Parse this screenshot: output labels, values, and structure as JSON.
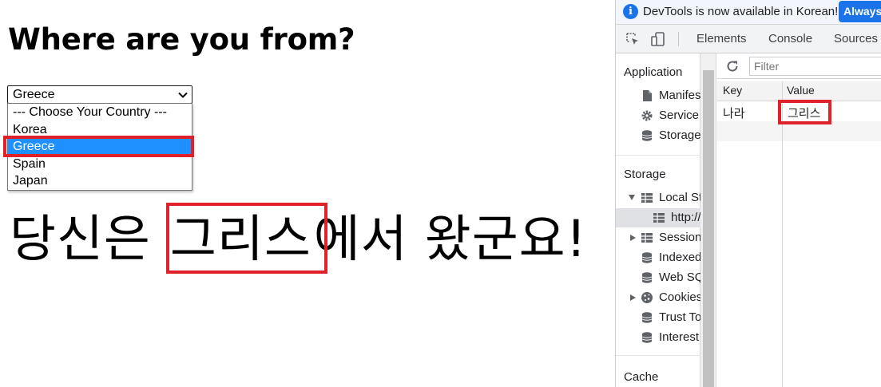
{
  "page": {
    "title": "Where are you from?",
    "select": {
      "value": "Greece",
      "options": [
        "--- Choose Your Country ---",
        "Korea",
        "Greece",
        "Spain",
        "Japan"
      ]
    },
    "result": {
      "prefix": "당신은 ",
      "country": "그리스",
      "suffix": "에서 왔군요!"
    }
  },
  "devtools": {
    "infobar": {
      "icon": "info-icon",
      "message": "DevTools is now available in Korean!",
      "button": "Always"
    },
    "tabs": [
      "Elements",
      "Console",
      "Sources"
    ],
    "sidebar": {
      "application_heading": "Application",
      "application_items": [
        {
          "label": "Manifest",
          "icon": "file-icon"
        },
        {
          "label": "Service Workers",
          "icon": "gear-icon"
        },
        {
          "label": "Storage",
          "icon": "database-icon"
        }
      ],
      "storage_heading": "Storage",
      "storage_items": [
        {
          "label": "Local Storage",
          "icon": "grid-icon",
          "expanded": true
        },
        {
          "label": "http://",
          "icon": "grid-icon",
          "active": true
        },
        {
          "label": "Session Storage",
          "icon": "grid-icon",
          "expanded": false
        },
        {
          "label": "IndexedDB",
          "icon": "database-icon"
        },
        {
          "label": "Web SQL",
          "icon": "database-icon"
        },
        {
          "label": "Cookies",
          "icon": "cookie-icon",
          "expanded": false
        },
        {
          "label": "Trust Tokens",
          "icon": "database-icon"
        },
        {
          "label": "Interest Groups",
          "icon": "database-icon"
        }
      ],
      "cache_heading": "Cache"
    },
    "main": {
      "filter_placeholder": "Filter",
      "columns": [
        "Key",
        "Value"
      ],
      "rows": [
        {
          "key": "나라",
          "value": "그리스"
        }
      ]
    }
  },
  "colors": {
    "highlight": "#e0212a",
    "selected_option": "#1e90ff",
    "accent": "#1a73e8"
  }
}
